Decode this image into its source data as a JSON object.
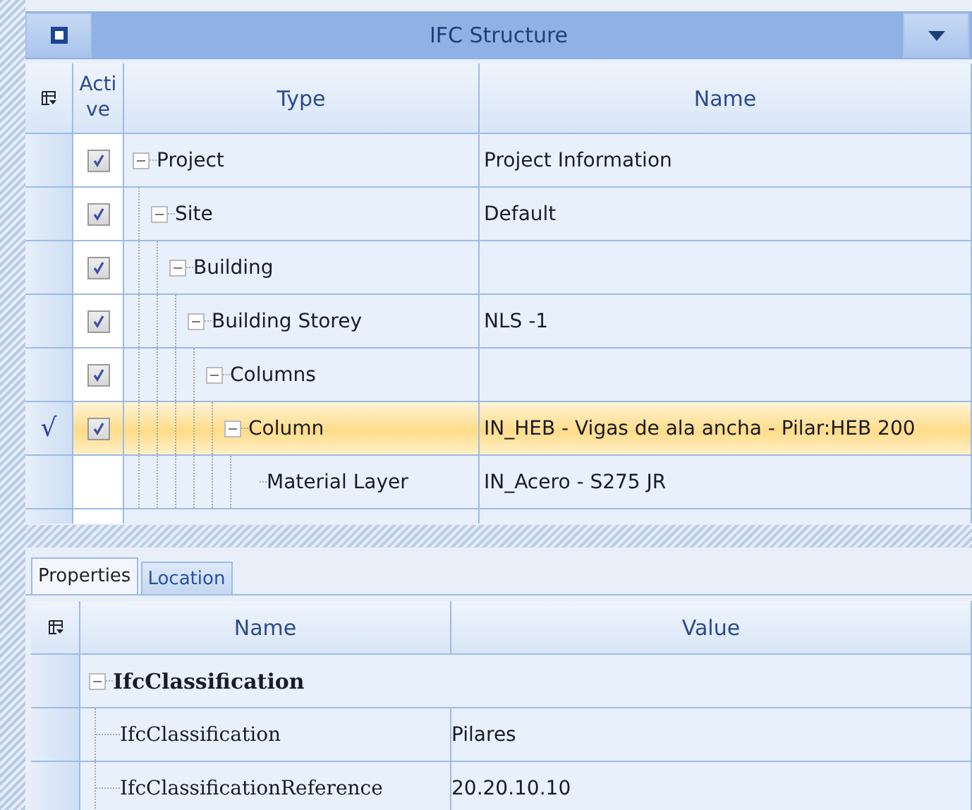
{
  "panel": {
    "title": "IFC Structure"
  },
  "structure": {
    "columns": [
      "Active",
      "Type",
      "Name"
    ],
    "rows": [
      {
        "kind": "node",
        "type": "Project",
        "name": "Project Information",
        "active": true,
        "expanded": true,
        "selected": false,
        "children": [
          {
            "kind": "node",
            "type": "Site",
            "name": "Default",
            "active": true,
            "expanded": true,
            "selected": false,
            "children": [
              {
                "kind": "node",
                "type": "Building",
                "active": true,
                "expanded": true,
                "selected": false,
                "children": [
                  {
                    "kind": "node",
                    "type": "Building Storey",
                    "name": "NLS -1",
                    "active": true,
                    "expanded": true,
                    "selected": false,
                    "children": [
                      {
                        "kind": "node",
                        "type": "Columns",
                        "active": true,
                        "expanded": true,
                        "selected": false,
                        "children": [
                          {
                            "kind": "node",
                            "type": "Column",
                            "name": "IN_HEB - Vigas de ala ancha - Pilar:HEB 200",
                            "active": true,
                            "expanded": true,
                            "selected": true,
                            "marker": "√",
                            "children": [
                              {
                                "kind": "layer",
                                "type": "Material Layer",
                                "name": "IN_Acero - S275 JR",
                                "selected": false
                              }
                            ]
                          }
                        ]
                      }
                    ]
                  }
                ]
              }
            ]
          }
        ]
      }
    ]
  },
  "tabs": [
    {
      "label": "Properties",
      "selected": true
    },
    {
      "label": "Location",
      "selected": false
    }
  ],
  "properties": {
    "columns": [
      "Name",
      "Value"
    ],
    "groups": [
      {
        "name": "IfcClassification",
        "expanded": true,
        "children": [
          {
            "name": "IfcClassification",
            "value": "Pilares"
          },
          {
            "name": "IfcClassificationReference",
            "value": "20.20.10.10"
          }
        ]
      }
    ]
  }
}
